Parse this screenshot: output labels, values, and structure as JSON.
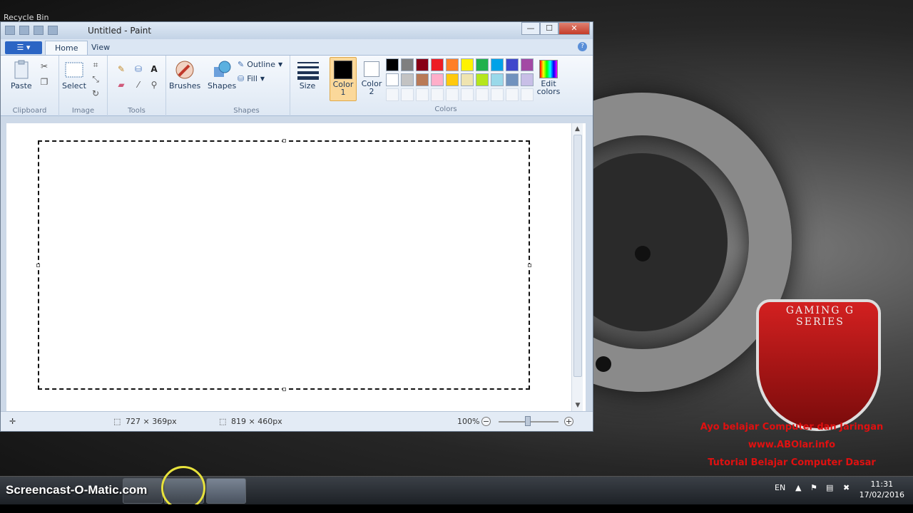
{
  "desktop": {
    "recycle_bin_label": "Recycle Bin",
    "brand_text": "GAMING G SERIES",
    "promo_lines": [
      "Ayo belajar Computer dan Jaringan",
      "www.ABOlar.info",
      "Tutorial Belajar Computer Dasar"
    ]
  },
  "window": {
    "title": "Untitled - Paint",
    "buttons": {
      "minimize": "—",
      "maximize": "☐",
      "close": "✕"
    }
  },
  "ribbon": {
    "tabs": [
      {
        "label": "Home",
        "active": true
      },
      {
        "label": "View",
        "active": false
      }
    ],
    "file_menu_label": "☰ ▾",
    "help_label": "?",
    "groups": {
      "clipboard": {
        "label": "Clipboard",
        "paste": "Paste"
      },
      "image": {
        "label": "Image",
        "select": "Select"
      },
      "tools": {
        "label": "Tools"
      },
      "brushes": {
        "label": "Brushes"
      },
      "shapes": {
        "label": "Shapes",
        "shapes_btn": "Shapes",
        "outline": "Outline",
        "fill": "Fill"
      },
      "size": {
        "label": "Size"
      },
      "colors": {
        "label": "Colors",
        "color1": "Color\n1",
        "color2": "Color\n2",
        "edit_colors": "Edit\ncolors",
        "color1_value": "#000000",
        "color2_value": "#ffffff",
        "palette": [
          "#000000",
          "#7f7f7f",
          "#880015",
          "#ed1c24",
          "#ff7f27",
          "#fff200",
          "#22b14c",
          "#00a2e8",
          "#3f48cc",
          "#a349a4",
          "#ffffff",
          "#c3c3c3",
          "#b97a57",
          "#ffaec9",
          "#ffc90e",
          "#efe4b0",
          "#b5e61d",
          "#99d9ea",
          "#7092be",
          "#c8bfe7"
        ]
      }
    }
  },
  "statusbar": {
    "selection_size": "727 × 369px",
    "image_size": "819 × 460px",
    "zoom": "100%",
    "zoom_out": "−",
    "zoom_in": "+"
  },
  "taskbar": {
    "watermark": "Screencast-O-Matic.com",
    "language": "EN",
    "time": "11:31",
    "date": "17/02/2016"
  }
}
